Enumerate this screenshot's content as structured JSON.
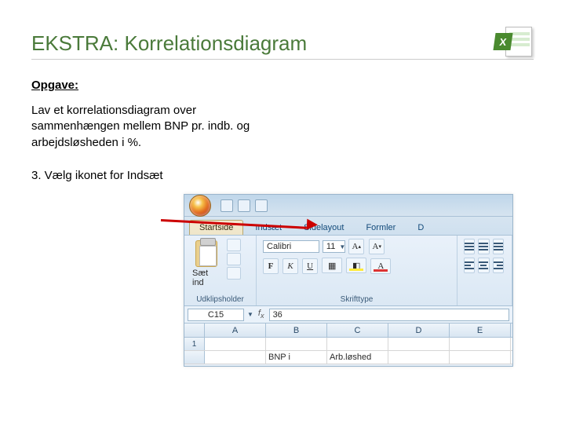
{
  "title": "EKSTRA: Korrelationsdiagram",
  "section_label": "Opgave:",
  "task_text": "Lav et korrelationsdiagram over sammenhængen mellem BNP pr. indb. og arbejdsløsheden i %.",
  "step_text": "3. Vælg ikonet for Indsæt",
  "excel_logo_letter": "X",
  "ribbon": {
    "tabs": [
      "Startside",
      "Indsæt",
      "Sidelayout",
      "Formler",
      "D"
    ],
    "clipboard": {
      "paste_label": "Sæt ind",
      "group_title": "Udklipsholder"
    },
    "font": {
      "font_name": "Calibri",
      "font_size": "11",
      "group_title": "Skrifttype",
      "bold": "F",
      "italic": "K",
      "underline": "U",
      "grow": "A",
      "shrink": "A"
    }
  },
  "namebox": "C15",
  "formula_value": "36",
  "columns": [
    "A",
    "B",
    "C",
    "D",
    "E"
  ],
  "rows": {
    "r1": {
      "num": "1",
      "cells": [
        "",
        "",
        "",
        "",
        ""
      ]
    },
    "r2": {
      "num": "",
      "cells": [
        "",
        "BNP i",
        "Arb.løshed",
        "",
        ""
      ]
    }
  }
}
